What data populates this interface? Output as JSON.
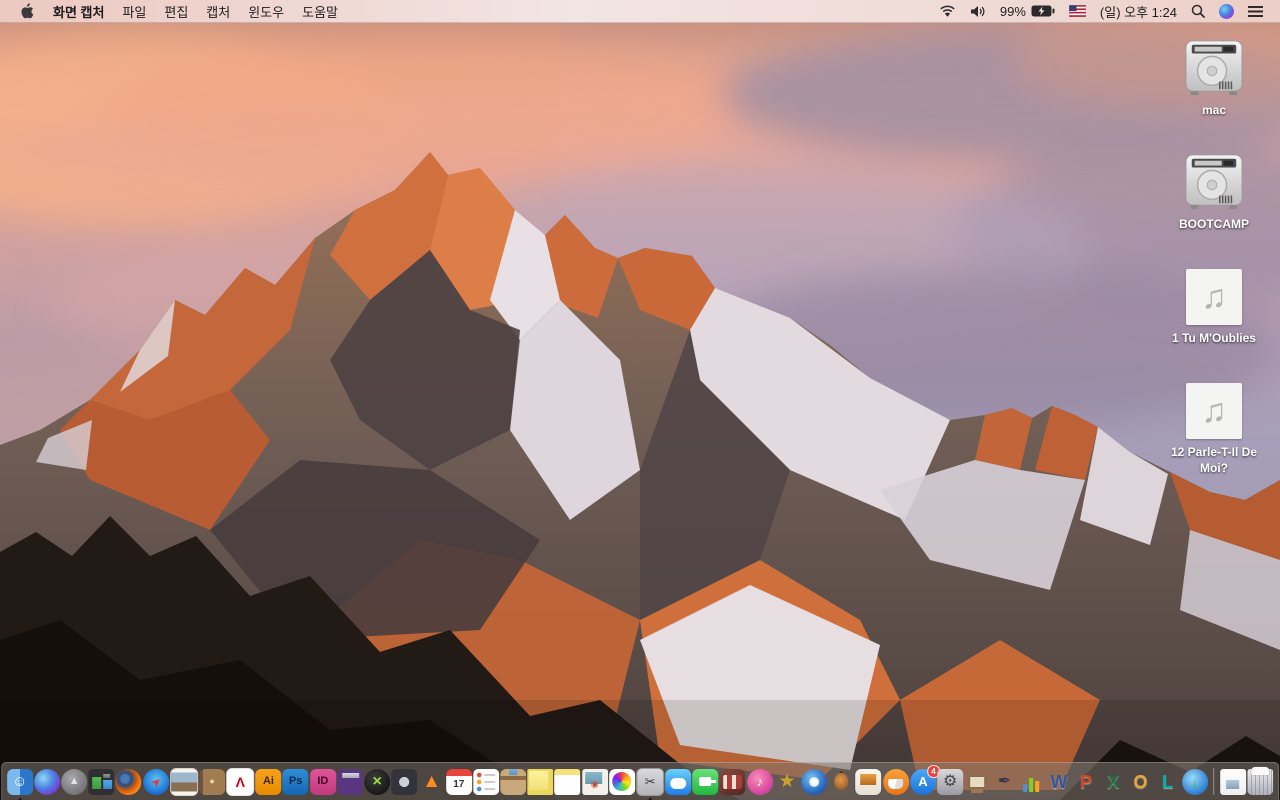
{
  "menu_bar": {
    "app_name": "화면 캡처",
    "menus": [
      "파일",
      "편집",
      "캡처",
      "윈도우",
      "도움말"
    ],
    "status": {
      "battery_percent": "99%",
      "battery_charging": true,
      "clock": "(일) 오후 1:24",
      "input_source": "us-flag"
    }
  },
  "desktop": {
    "icons": [
      {
        "label": "mac",
        "type": "drive"
      },
      {
        "label": "BOOTCAMP",
        "type": "drive"
      },
      {
        "label": "1 Tu M'Oublies",
        "type": "audio"
      },
      {
        "label": "12 Parle-T-Il De Moi?",
        "type": "audio"
      }
    ]
  },
  "dock": {
    "calendar_day": "17",
    "app_store_badge": "4",
    "items": [
      {
        "name": "finder",
        "running": true
      },
      {
        "name": "siri"
      },
      {
        "name": "launchpad"
      },
      {
        "name": "mission-control"
      },
      {
        "name": "firefox"
      },
      {
        "name": "safari"
      },
      {
        "name": "preview"
      },
      {
        "name": "contacts"
      },
      {
        "name": "acrobat-reader"
      },
      {
        "name": "illustrator"
      },
      {
        "name": "photoshop"
      },
      {
        "name": "indesign"
      },
      {
        "name": "toast"
      },
      {
        "name": "media-player-x"
      },
      {
        "name": "dvd-player"
      },
      {
        "name": "vlc"
      },
      {
        "name": "calendar",
        "glyph": "17"
      },
      {
        "name": "reminders"
      },
      {
        "name": "archive-utility"
      },
      {
        "name": "stickies"
      },
      {
        "name": "notes"
      },
      {
        "name": "image-capture"
      },
      {
        "name": "photos"
      },
      {
        "name": "grab",
        "running": true
      },
      {
        "name": "messages"
      },
      {
        "name": "facetime"
      },
      {
        "name": "photo-booth"
      },
      {
        "name": "itunes"
      },
      {
        "name": "imovie"
      },
      {
        "name": "idvd"
      },
      {
        "name": "garageband"
      },
      {
        "name": "iweb"
      },
      {
        "name": "ibooks"
      },
      {
        "name": "app-store",
        "badge": "4"
      },
      {
        "name": "system-preferences"
      },
      {
        "name": "keynote"
      },
      {
        "name": "pages"
      },
      {
        "name": "numbers"
      },
      {
        "name": "word"
      },
      {
        "name": "powerpoint"
      },
      {
        "name": "excel"
      },
      {
        "name": "outlook"
      },
      {
        "name": "lync"
      },
      {
        "name": "downloader"
      },
      {
        "name": "separator",
        "type": "separator"
      },
      {
        "name": "document"
      },
      {
        "name": "trash"
      }
    ]
  },
  "colors": {
    "menubar_bg": "#f0dcd8",
    "dock_bg": "rgba(128,118,112,0.55)",
    "badge_red": "#e8453a",
    "label_text": "#ffffff"
  }
}
